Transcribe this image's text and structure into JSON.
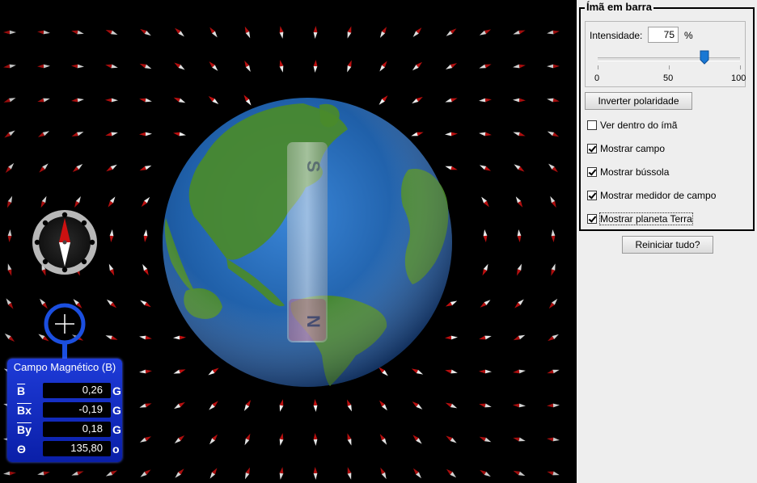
{
  "panel": {
    "group_title": "Ímã em barra",
    "intensity_label": "Intensidade:",
    "intensity_value": "75",
    "intensity_unit": "%",
    "slider_level_percent": 75,
    "slider_labels": [
      "0",
      "50",
      "100"
    ],
    "invert_button": "Inverter polaridade",
    "checkboxes": [
      {
        "label": "Ver dentro do ímã",
        "checked": false
      },
      {
        "label": "Mostrar campo",
        "checked": true
      },
      {
        "label": "Mostrar bússola",
        "checked": true
      },
      {
        "label": "Mostrar medidor de campo",
        "checked": true
      },
      {
        "label": "Mostrar planeta Terra",
        "checked": true
      }
    ],
    "reset_button": "Reiniciar tudo?"
  },
  "magnet": {
    "top_pole": "S",
    "bottom_pole": "N"
  },
  "meter": {
    "title": "Campo Magnético (B)",
    "rows": [
      {
        "symbol": "B",
        "value": "0,26",
        "unit": "G"
      },
      {
        "symbol": "Bx",
        "value": "-0,19",
        "unit": "G"
      },
      {
        "symbol": "By",
        "value": "0,18",
        "unit": "G"
      },
      {
        "symbol": "Θ",
        "value": "135,80",
        "unit": "o"
      }
    ]
  },
  "colors": {
    "background": "#000000",
    "panel_bg": "#eeeeee",
    "ocean": "#1f5fa8",
    "land": "#4a8a2a",
    "needle_north": "#cc1111",
    "needle_south": "#ffffff",
    "meter_blue": "#1e3bd8",
    "slider_thumb": "#1a78d4"
  }
}
